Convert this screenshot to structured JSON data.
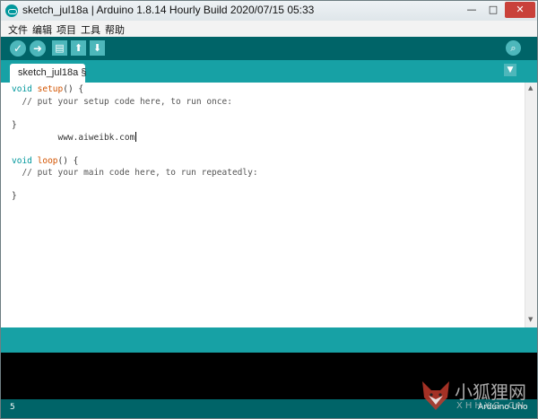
{
  "window": {
    "title": "sketch_jul18a | Arduino 1.8.14 Hourly Build 2020/07/15 05:33",
    "min_glyph": "—",
    "max_glyph": "□",
    "close_glyph": "✕"
  },
  "menu": {
    "items": [
      {
        "label": "文件"
      },
      {
        "label": "编辑"
      },
      {
        "label": "项目"
      },
      {
        "label": "工具"
      },
      {
        "label": "帮助"
      }
    ]
  },
  "toolbar": {
    "buttons": [
      {
        "name": "verify-button",
        "icon": "check-icon",
        "glyph": "✓"
      },
      {
        "name": "upload-button",
        "icon": "arrow-right-icon",
        "glyph": "➜"
      },
      {
        "name": "new-button",
        "icon": "new-file-icon",
        "glyph": "▤"
      },
      {
        "name": "open-button",
        "icon": "arrow-up-icon",
        "glyph": "⬆"
      },
      {
        "name": "save-button",
        "icon": "arrow-down-icon",
        "glyph": "⬇"
      }
    ],
    "serial_monitor": {
      "icon": "magnifier-icon",
      "glyph": "⌕"
    }
  },
  "tabs": {
    "active_label": "sketch_jul18a §",
    "menu_glyph": "▼"
  },
  "editor": {
    "lines": [
      {
        "kw": "void",
        "fn": "setup",
        "rest": "() {"
      },
      {
        "comment": "  // put your setup code here, to run once:"
      },
      {
        "text": ""
      },
      {
        "text": "}"
      },
      {
        "typed": "         www.aiweibk.com"
      },
      {
        "text": ""
      },
      {
        "kw": "void",
        "fn": "loop",
        "rest": "() {"
      },
      {
        "comment": "  // put your main code here, to run repeatedly:"
      },
      {
        "text": ""
      },
      {
        "text": "}"
      }
    ]
  },
  "status": {
    "line_number": "5",
    "board": "Arduino Uno"
  },
  "watermark": {
    "cn": "小狐狸网",
    "en": "XHHXG.CN"
  },
  "colors": {
    "toolbar_dark": "#006468",
    "teal": "#17a1a5",
    "button": "#4db7bb",
    "keyword": "#00979c",
    "function": "#d35400"
  }
}
